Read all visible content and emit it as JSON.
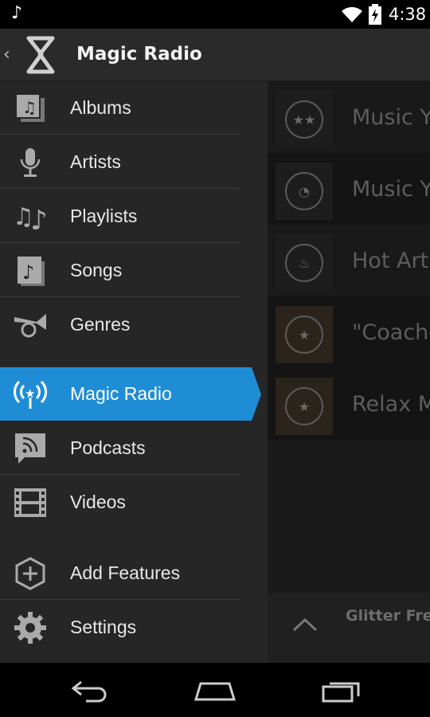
{
  "status_bar": {
    "time": "4:38",
    "notification_icon": "music-note-icon",
    "wifi_icon": "wifi-icon",
    "battery_icon": "battery-charging-icon"
  },
  "action_bar": {
    "title": "Magic Radio",
    "back_icon": "chevron-left-icon",
    "logo_icon": "app-logo-icon"
  },
  "drawer": {
    "items": [
      {
        "label": "Albums",
        "icon": "albums-icon"
      },
      {
        "label": "Artists",
        "icon": "microphone-icon"
      },
      {
        "label": "Playlists",
        "icon": "playlist-icon"
      },
      {
        "label": "Songs",
        "icon": "song-icon"
      },
      {
        "label": "Genres",
        "icon": "genres-horn-icon"
      },
      {
        "label": "Magic Radio",
        "icon": "radio-antenna-icon",
        "selected": true
      },
      {
        "label": "Podcasts",
        "icon": "podcast-icon"
      },
      {
        "label": "Videos",
        "icon": "film-icon"
      },
      {
        "label": "Add Features",
        "icon": "add-hexagon-icon"
      },
      {
        "label": "Settings",
        "icon": "gear-icon"
      }
    ]
  },
  "stations": [
    {
      "name": "Music Y",
      "icon": "stars-icon"
    },
    {
      "name": "Music Y",
      "icon": "radar-icon"
    },
    {
      "name": "Hot Arti",
      "icon": "flame-icon"
    },
    {
      "name": "\"Coache",
      "icon": "radio-star-icon"
    },
    {
      "name": "Relax M",
      "icon": "radio-star-icon"
    }
  ],
  "mini_player": {
    "song": "Glitter Free",
    "expand_icon": "chevron-up-icon"
  },
  "colors": {
    "accent": "#1f8dd6",
    "drawer_bg": "#262626",
    "action_bar_bg": "#2a2a2a"
  },
  "nav_bar": {
    "back_icon": "nav-back-icon",
    "home_icon": "nav-home-icon",
    "recents_icon": "nav-recents-icon"
  }
}
